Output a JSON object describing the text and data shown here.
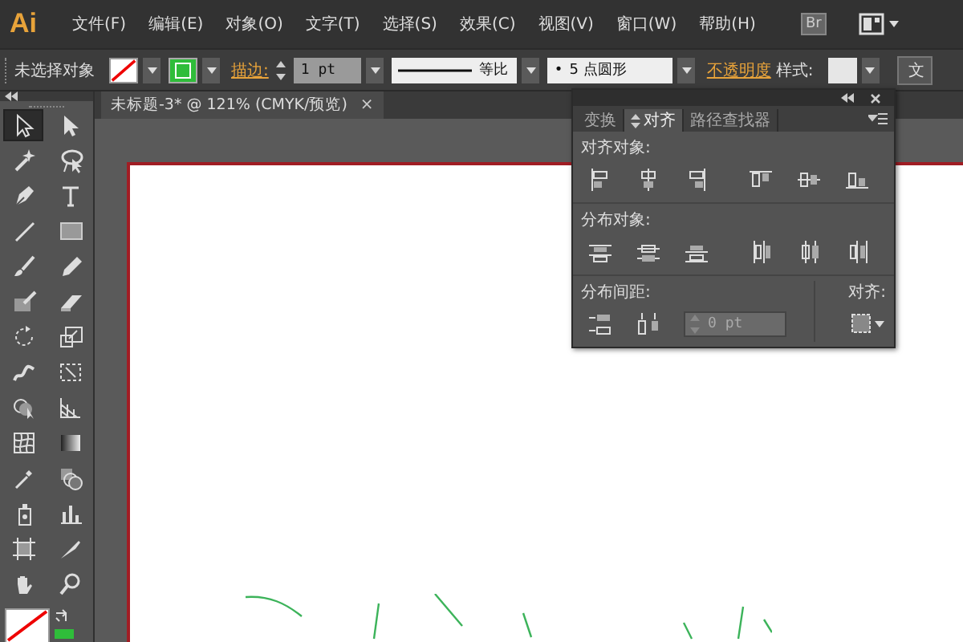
{
  "menu_bar": {
    "logo": "Ai",
    "items": [
      "文件(F)",
      "编辑(E)",
      "对象(O)",
      "文字(T)",
      "选择(S)",
      "效果(C)",
      "视图(V)",
      "窗口(W)",
      "帮助(H)"
    ],
    "bridge_button": "Br"
  },
  "control_bar": {
    "selection_label": "未选择对象",
    "stroke_label": "描边:",
    "stroke_weight": "1 pt",
    "stroke_profile": "等比",
    "brush": "5 点圆形",
    "brush_bullet": "•",
    "opacity_label": "不透明度",
    "style_label": "样式:",
    "cut_button": "文"
  },
  "document_tab": {
    "title": "未标题-3* @ 121% (CMYK/预览)",
    "close": "×"
  },
  "tools": [
    {
      "kind": "select",
      "selected": true
    },
    {
      "kind": "direct",
      "selected": false
    },
    {
      "kind": "wand",
      "selected": false
    },
    {
      "kind": "lasso",
      "selected": false
    },
    {
      "kind": "pen",
      "selected": false
    },
    {
      "kind": "type",
      "selected": false
    },
    {
      "kind": "line",
      "selected": false
    },
    {
      "kind": "rect",
      "selected": false
    },
    {
      "kind": "brush",
      "selected": false
    },
    {
      "kind": "pencil",
      "selected": false
    },
    {
      "kind": "blob",
      "selected": false
    },
    {
      "kind": "eraser",
      "selected": false
    },
    {
      "kind": "rotate",
      "selected": false
    },
    {
      "kind": "scale",
      "selected": false
    },
    {
      "kind": "warp",
      "selected": false
    },
    {
      "kind": "free",
      "selected": false
    },
    {
      "kind": "builder",
      "selected": false
    },
    {
      "kind": "perspective",
      "selected": false
    },
    {
      "kind": "mesh",
      "selected": false
    },
    {
      "kind": "gradient",
      "selected": false
    },
    {
      "kind": "eyedropper",
      "selected": false
    },
    {
      "kind": "blend",
      "selected": false
    },
    {
      "kind": "sprayer",
      "selected": false
    },
    {
      "kind": "graph",
      "selected": false
    },
    {
      "kind": "artboard",
      "selected": false
    },
    {
      "kind": "slice",
      "selected": false
    },
    {
      "kind": "hand",
      "selected": false
    },
    {
      "kind": "zoom",
      "selected": false
    }
  ],
  "align_panel": {
    "tabs": [
      {
        "label": "变换",
        "selected": false
      },
      {
        "label": "对齐",
        "selected": true
      },
      {
        "label": "路径查找器",
        "selected": false
      }
    ],
    "sections": [
      {
        "title": "对齐对象:",
        "icons": [
          {
            "kind": "left"
          },
          {
            "kind": "hcenter"
          },
          {
            "kind": "right"
          },
          {
            "kind": "top"
          },
          {
            "kind": "vcenter"
          },
          {
            "kind": "bottom"
          }
        ]
      },
      {
        "title": "分布对象:",
        "icons": [
          {
            "kind": "dtop"
          },
          {
            "kind": "dvcenter"
          },
          {
            "kind": "dbottom"
          },
          {
            "kind": "dleft"
          },
          {
            "kind": "dhcenter"
          },
          {
            "kind": "dright"
          }
        ]
      }
    ],
    "spacing": {
      "title": "分布间距:",
      "icons": [
        {
          "kind": "vspace"
        },
        {
          "kind": "hspace"
        }
      ],
      "value": "0 pt"
    },
    "align_to_label": "对齐:"
  }
}
